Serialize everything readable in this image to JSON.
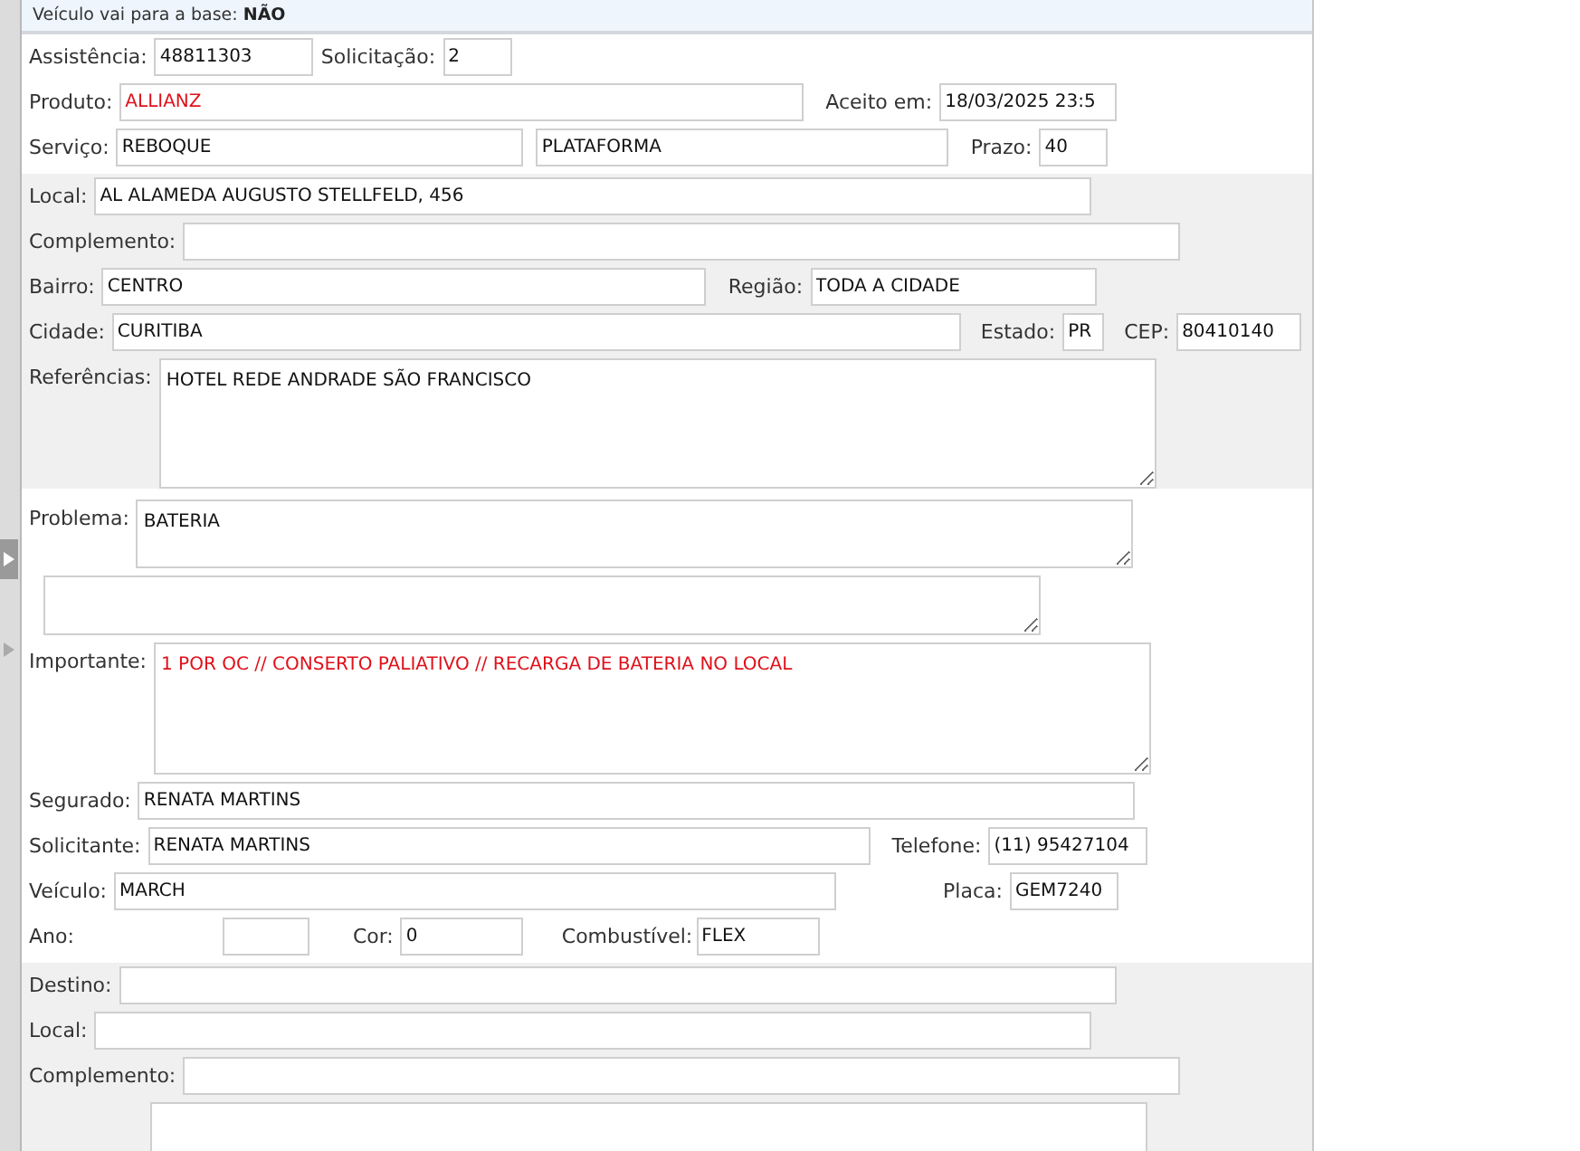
{
  "banner": {
    "label": "Veículo vai para a base:",
    "value": "NÃO"
  },
  "sections": [
    {
      "shaded": false,
      "lines": [
        {
          "fields": [
            {
              "kind": "input",
              "label": "Assistência:",
              "value": "48811303",
              "alert": false
            },
            {
              "kind": "input",
              "label": "Solicitação:",
              "value": "2",
              "alert": false
            }
          ]
        },
        {
          "fields": [
            {
              "kind": "input",
              "label": "Produto:",
              "value": "ALLIANZ",
              "alert": true
            },
            {
              "kind": "input",
              "label": "Aceito em:",
              "value": "18/03/2025 23:5",
              "alert": false
            }
          ]
        },
        {
          "fields": [
            {
              "kind": "input",
              "label": "Serviço:",
              "value": "REBOQUE",
              "alert": false
            },
            {
              "kind": "input",
              "value": "PLATAFORMA",
              "alert": false
            },
            {
              "kind": "input",
              "label": "Prazo:",
              "value": "40",
              "alert": false
            }
          ]
        }
      ]
    },
    {
      "shaded": true,
      "lines": [
        {
          "fields": [
            {
              "kind": "input",
              "label": "Local:",
              "value": "AL ALAMEDA AUGUSTO STELLFELD, 456",
              "alert": false
            }
          ]
        },
        {
          "fields": [
            {
              "kind": "input",
              "label": "Complemento:"
            }
          ]
        },
        {
          "fields": [
            {
              "kind": "input",
              "label": "Bairro:",
              "value": "CENTRO",
              "alert": false
            },
            {
              "kind": "input",
              "label": "Região:",
              "value": "TODA A CIDADE",
              "alert": false
            }
          ]
        },
        {
          "fields": [
            {
              "kind": "input",
              "label": "Cidade:",
              "value": "CURITIBA",
              "alert": false
            },
            {
              "kind": "input",
              "label": "Estado:",
              "value": "PR",
              "alert": false
            },
            {
              "kind": "input",
              "label": "CEP:",
              "value": "80410140",
              "alert": false
            }
          ]
        },
        {
          "fields": [
            {
              "kind": "textarea",
              "label": "Referências:",
              "value": "HOTEL REDE ANDRADE SÃO FRANCISCO",
              "alert": false
            }
          ]
        }
      ]
    },
    {
      "shaded": false,
      "lines": [
        {
          "fields": [
            {
              "kind": "textarea",
              "label": "Problema:",
              "value": "BATERIA",
              "alert": false
            }
          ]
        },
        {
          "fields": [
            {
              "kind": "textarea"
            }
          ]
        },
        {
          "fields": [
            {
              "kind": "textarea",
              "label": "Importante:",
              "value": "1 POR OC // CONSERTO PALIATIVO // RECARGA DE BATERIA NO LOCAL",
              "alert": true
            }
          ]
        },
        {
          "fields": [
            {
              "kind": "input",
              "label": "Segurado:",
              "value": "RENATA MARTINS",
              "alert": false
            }
          ]
        },
        {
          "fields": [
            {
              "kind": "input",
              "label": "Solicitante:",
              "value": "RENATA MARTINS",
              "alert": false
            },
            {
              "kind": "input",
              "label": "Telefone:",
              "value": "(11) 95427104",
              "alert": false
            }
          ]
        },
        {
          "fields": [
            {
              "kind": "input",
              "label": "Veículo:",
              "value": "MARCH",
              "alert": false
            },
            {
              "kind": "input",
              "label": "Placa:",
              "value": "GEM7240",
              "alert": false
            }
          ]
        },
        {
          "fields": [
            {
              "kind": "input",
              "label": "Ano:"
            },
            {
              "kind": "input",
              "label": "Cor:",
              "value": "0",
              "alert": false
            },
            {
              "kind": "input",
              "label": "Combustível:",
              "value": "FLEX",
              "alert": false
            }
          ]
        }
      ]
    },
    {
      "shaded": true,
      "lines": [
        {
          "fields": [
            {
              "kind": "input",
              "label": "Destino:"
            }
          ]
        },
        {
          "fields": [
            {
              "kind": "input",
              "label": "Local:"
            }
          ]
        },
        {
          "fields": [
            {
              "kind": "input",
              "label": "Complemento:"
            }
          ]
        },
        {
          "fields": [
            {
              "kind": "textarea"
            }
          ]
        }
      ]
    }
  ]
}
